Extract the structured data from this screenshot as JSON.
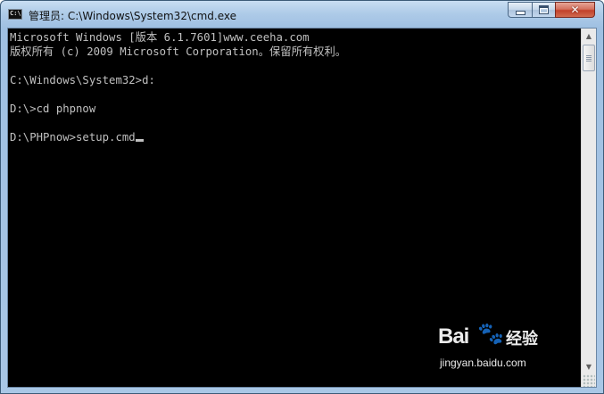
{
  "window": {
    "title": "管理员: C:\\Windows\\System32\\cmd.exe",
    "app_icon_text": "C:\\"
  },
  "caption_buttons": {
    "minimize_icon": "minimize-icon",
    "maximize_icon": "maximize-icon",
    "close_glyph": "✕"
  },
  "console": {
    "lines": [
      "Microsoft Windows [版本 6.1.7601]www.ceeha.com",
      "版权所有 (c) 2009 Microsoft Corporation。保留所有权利。",
      "",
      "C:\\Windows\\System32>d:",
      "",
      "D:\\>cd phpnow",
      "",
      "D:\\PHPnow>setup.cmd"
    ],
    "background": "#000000",
    "foreground": "#c0c0c0"
  },
  "scrollbar": {
    "up_arrow": "▲",
    "down_arrow": "▼"
  },
  "watermark": {
    "logo_text": "Bai",
    "paw": "🐾",
    "cn_text": "经验",
    "url": "jingyan.baidu.com"
  }
}
